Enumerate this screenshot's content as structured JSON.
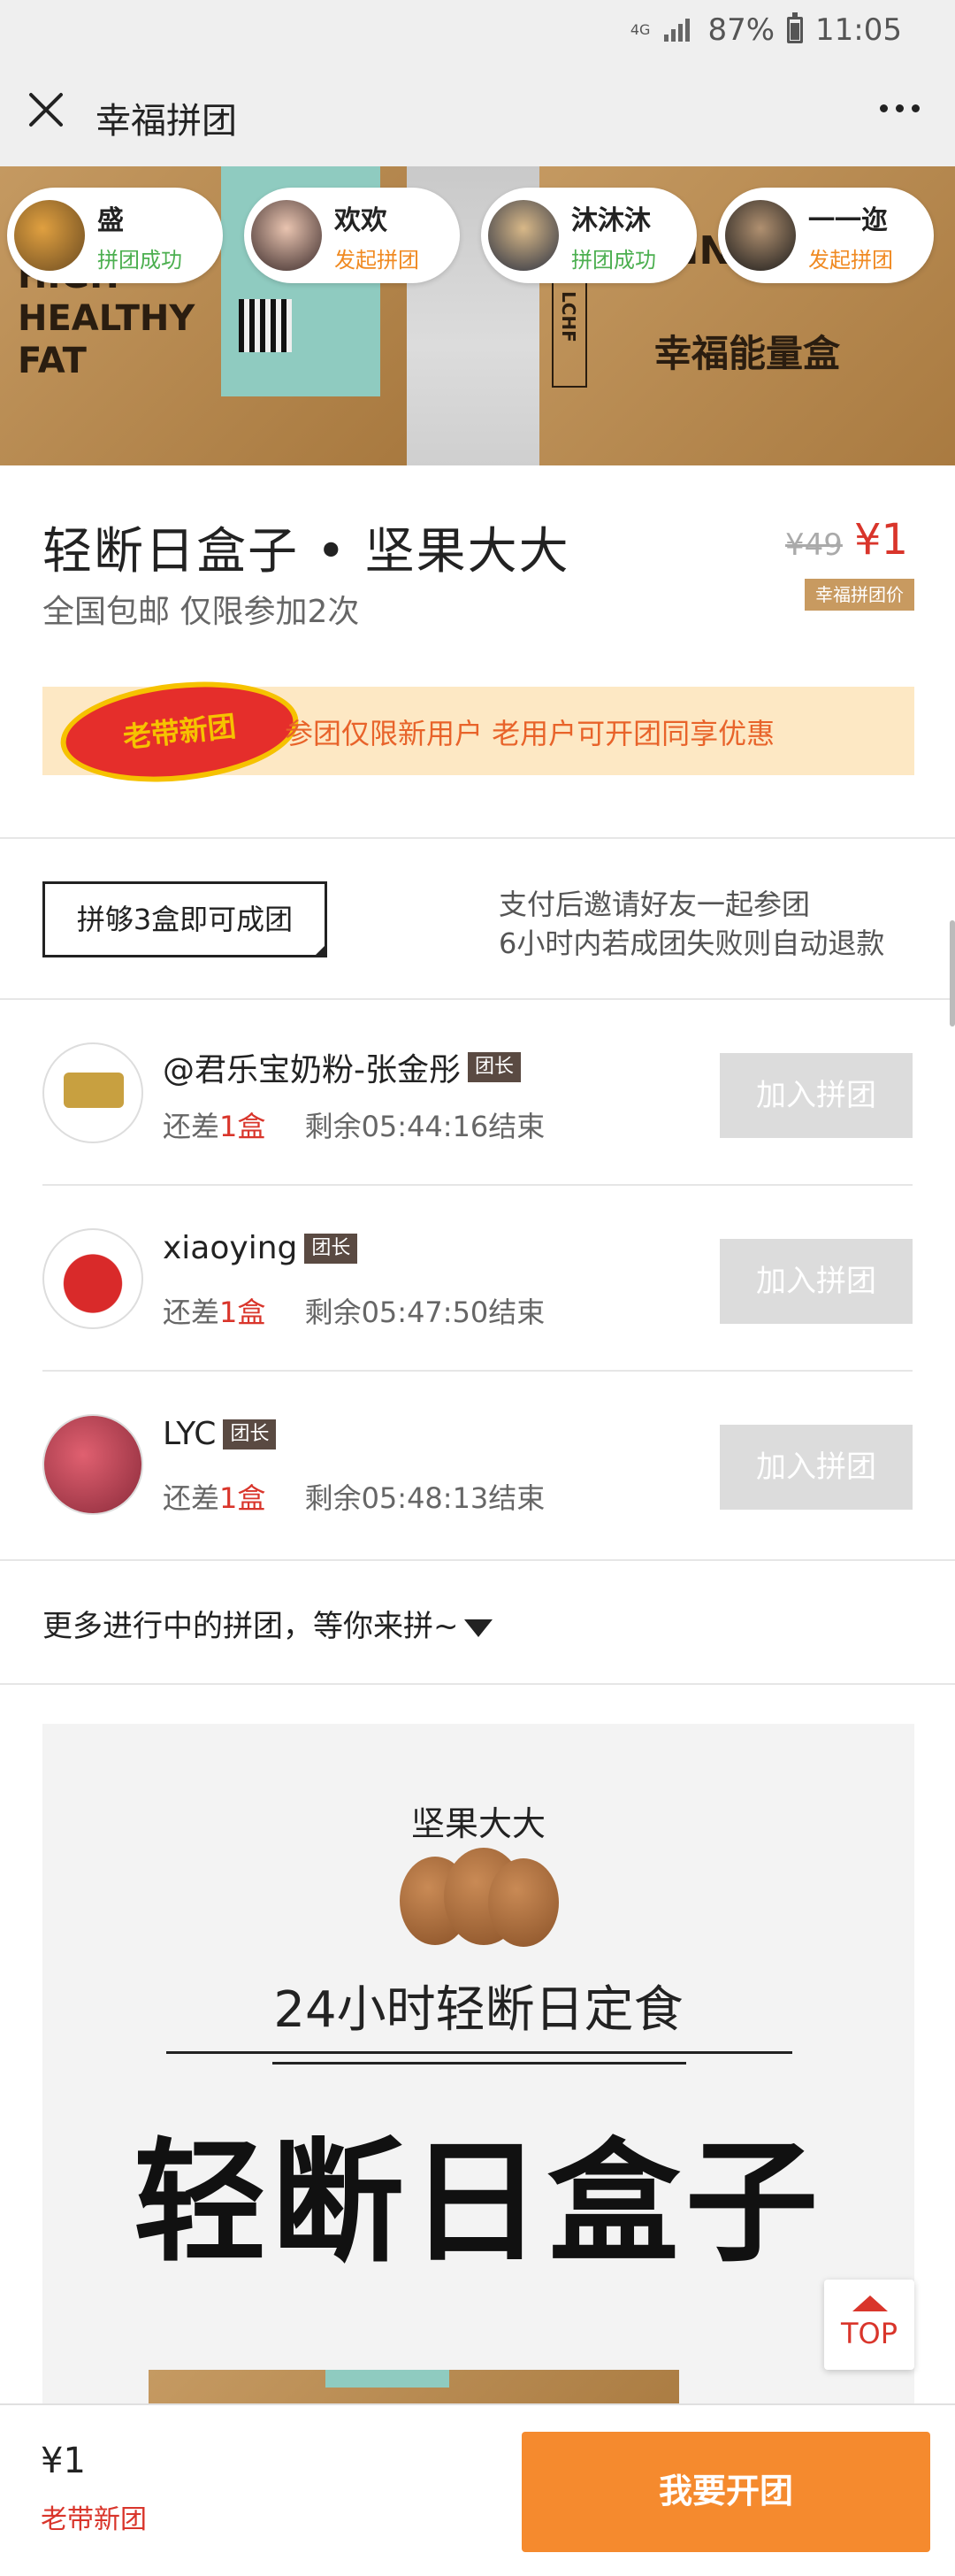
{
  "status_bar": {
    "network": "4G",
    "battery_pct": "87%",
    "time": "11:05"
  },
  "title_bar": {
    "title": "幸福拼团"
  },
  "hero": {
    "box_left_text": "HIGH HEALTHY FAT",
    "box_right_text": "KING BOX",
    "box_right_text2": "幸福能量盒",
    "box_right_side": "LCHF",
    "buyers": [
      {
        "name": "盛",
        "status": "拼团成功",
        "status_color": "#4caf50"
      },
      {
        "name": "欢欢",
        "status": "发起拼团",
        "status_color": "#f08a22"
      },
      {
        "name": "沐沐沐",
        "status": "拼团成功",
        "status_color": "#4caf50"
      },
      {
        "name": "一一迩",
        "status": "发起拼团",
        "status_color": "#f08a22"
      }
    ]
  },
  "product": {
    "title": "轻断日盒子 • 坚果大大",
    "subtitle": "全国包邮 仅限参加2次",
    "old_price": "¥49",
    "price": "¥1",
    "price_tag": "幸福拼团价"
  },
  "promo": {
    "badge": "老带新团",
    "text": "参团仅限新用户 老用户可开团同享优惠"
  },
  "rules": {
    "box": "拼够3盒即可成团",
    "line1": "支付后邀请好友一起参团",
    "line2": "6小时内若成团失败则自动退款"
  },
  "groups": [
    {
      "name": "@君乐宝奶粉-张金彤",
      "badge": "团长",
      "remain_prefix": "还差",
      "remain_count": "1盒",
      "timer": "剩余05:44:16结束",
      "join_label": "加入拼团"
    },
    {
      "name": "xiaoying",
      "badge": "团长",
      "remain_prefix": "还差",
      "remain_count": "1盒",
      "timer": "剩余05:47:50结束",
      "join_label": "加入拼团"
    },
    {
      "name": "LYC",
      "badge": "团长",
      "remain_prefix": "还差",
      "remain_count": "1盒",
      "timer": "剩余05:48:13结束",
      "join_label": "加入拼团"
    }
  ],
  "more": {
    "text": "更多进行中的拼团，等你来拼~"
  },
  "detail": {
    "brand": "坚果大大",
    "subtitle": "24小时轻断日定食",
    "big_title": "轻断日盒子"
  },
  "top_button": {
    "label": "TOP"
  },
  "bottom_bar": {
    "price": "¥1",
    "label": "老带新团",
    "button": "我要开团"
  },
  "colors": {
    "accent": "#f58a2e",
    "price_red": "#d9352b",
    "badge_brown": "#5a4a42",
    "tag_gold": "#c89a60"
  }
}
